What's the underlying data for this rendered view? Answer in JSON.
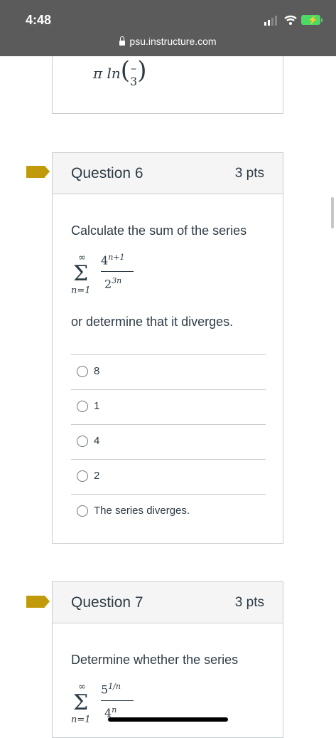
{
  "status": {
    "time": "4:48",
    "url": "psu.instructure.com"
  },
  "prev_answer": {
    "math": "π ln",
    "fraction_num": "–",
    "fraction_den": "3"
  },
  "q6": {
    "title": "Question 6",
    "points": "3 pts",
    "prompt": "Calculate the sum of the series",
    "series": {
      "upper": "∞",
      "lower": "n=1",
      "sigma": "Σ",
      "num_base": "4",
      "num_exp": "n+1",
      "den_base": "2",
      "den_exp": "3n"
    },
    "suffix": "or determine that it diverges.",
    "answers": [
      "8",
      "1",
      "4",
      "2",
      "The series diverges."
    ]
  },
  "q7": {
    "title": "Question 7",
    "points": "3 pts",
    "prompt": "Determine whether the series",
    "series": {
      "upper": "∞",
      "lower": "n=1",
      "sigma": "Σ",
      "num_base": "5",
      "num_exp": "1/n",
      "den_base": "4",
      "den_exp": "n"
    }
  },
  "icons": [
    "signal-icon",
    "wifi-icon",
    "battery-icon",
    "lock-icon",
    "flag-icon",
    "radio-icon"
  ],
  "colors": {
    "statusbar": "#5b5b5b",
    "flag": "#c19a0b",
    "battery": "#4cd964",
    "text": "#2d3b45"
  }
}
